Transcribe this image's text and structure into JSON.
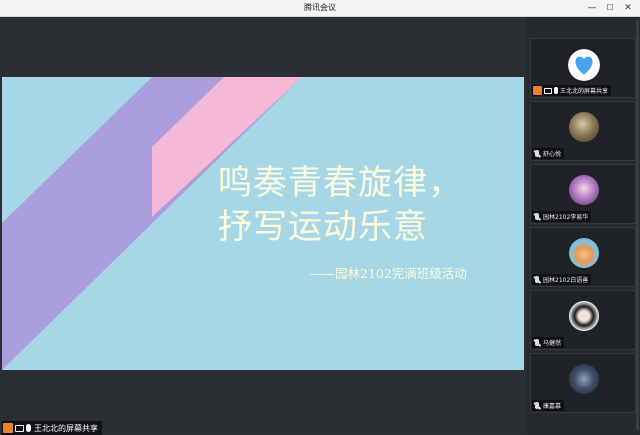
{
  "window": {
    "title": "腾讯会议",
    "min": "—",
    "max": "☐",
    "close": "✕"
  },
  "slide": {
    "title_line1": "鸣奏青春旋律，",
    "title_line2": "抒写运动乐意",
    "subtitle": "——园林2102完满班级活动",
    "colors": {
      "bg": "#a7d7e7",
      "stripe_purple": "#ab9edc",
      "stripe_pink": "#f5b9d8",
      "text": "#fbfbde"
    }
  },
  "share_bar": {
    "label": "王北北的屏幕共享"
  },
  "participants": [
    {
      "name": "王北北的屏幕共享",
      "avatar": "heart-icon",
      "sharing": true,
      "mic": "on"
    },
    {
      "name": "舒心悦",
      "avatar": "avatar-photo",
      "sharing": false,
      "mic": "muted"
    },
    {
      "name": "园林2102李易华",
      "avatar": "avatar-photo",
      "sharing": false,
      "mic": "muted"
    },
    {
      "name": "园林2102白语善",
      "avatar": "avatar-photo",
      "sharing": false,
      "mic": "muted"
    },
    {
      "name": "马健然",
      "avatar": "avatar-photo",
      "sharing": false,
      "mic": "muted"
    },
    {
      "name": "康嘉慕",
      "avatar": "avatar-photo",
      "sharing": false,
      "mic": "muted"
    }
  ]
}
